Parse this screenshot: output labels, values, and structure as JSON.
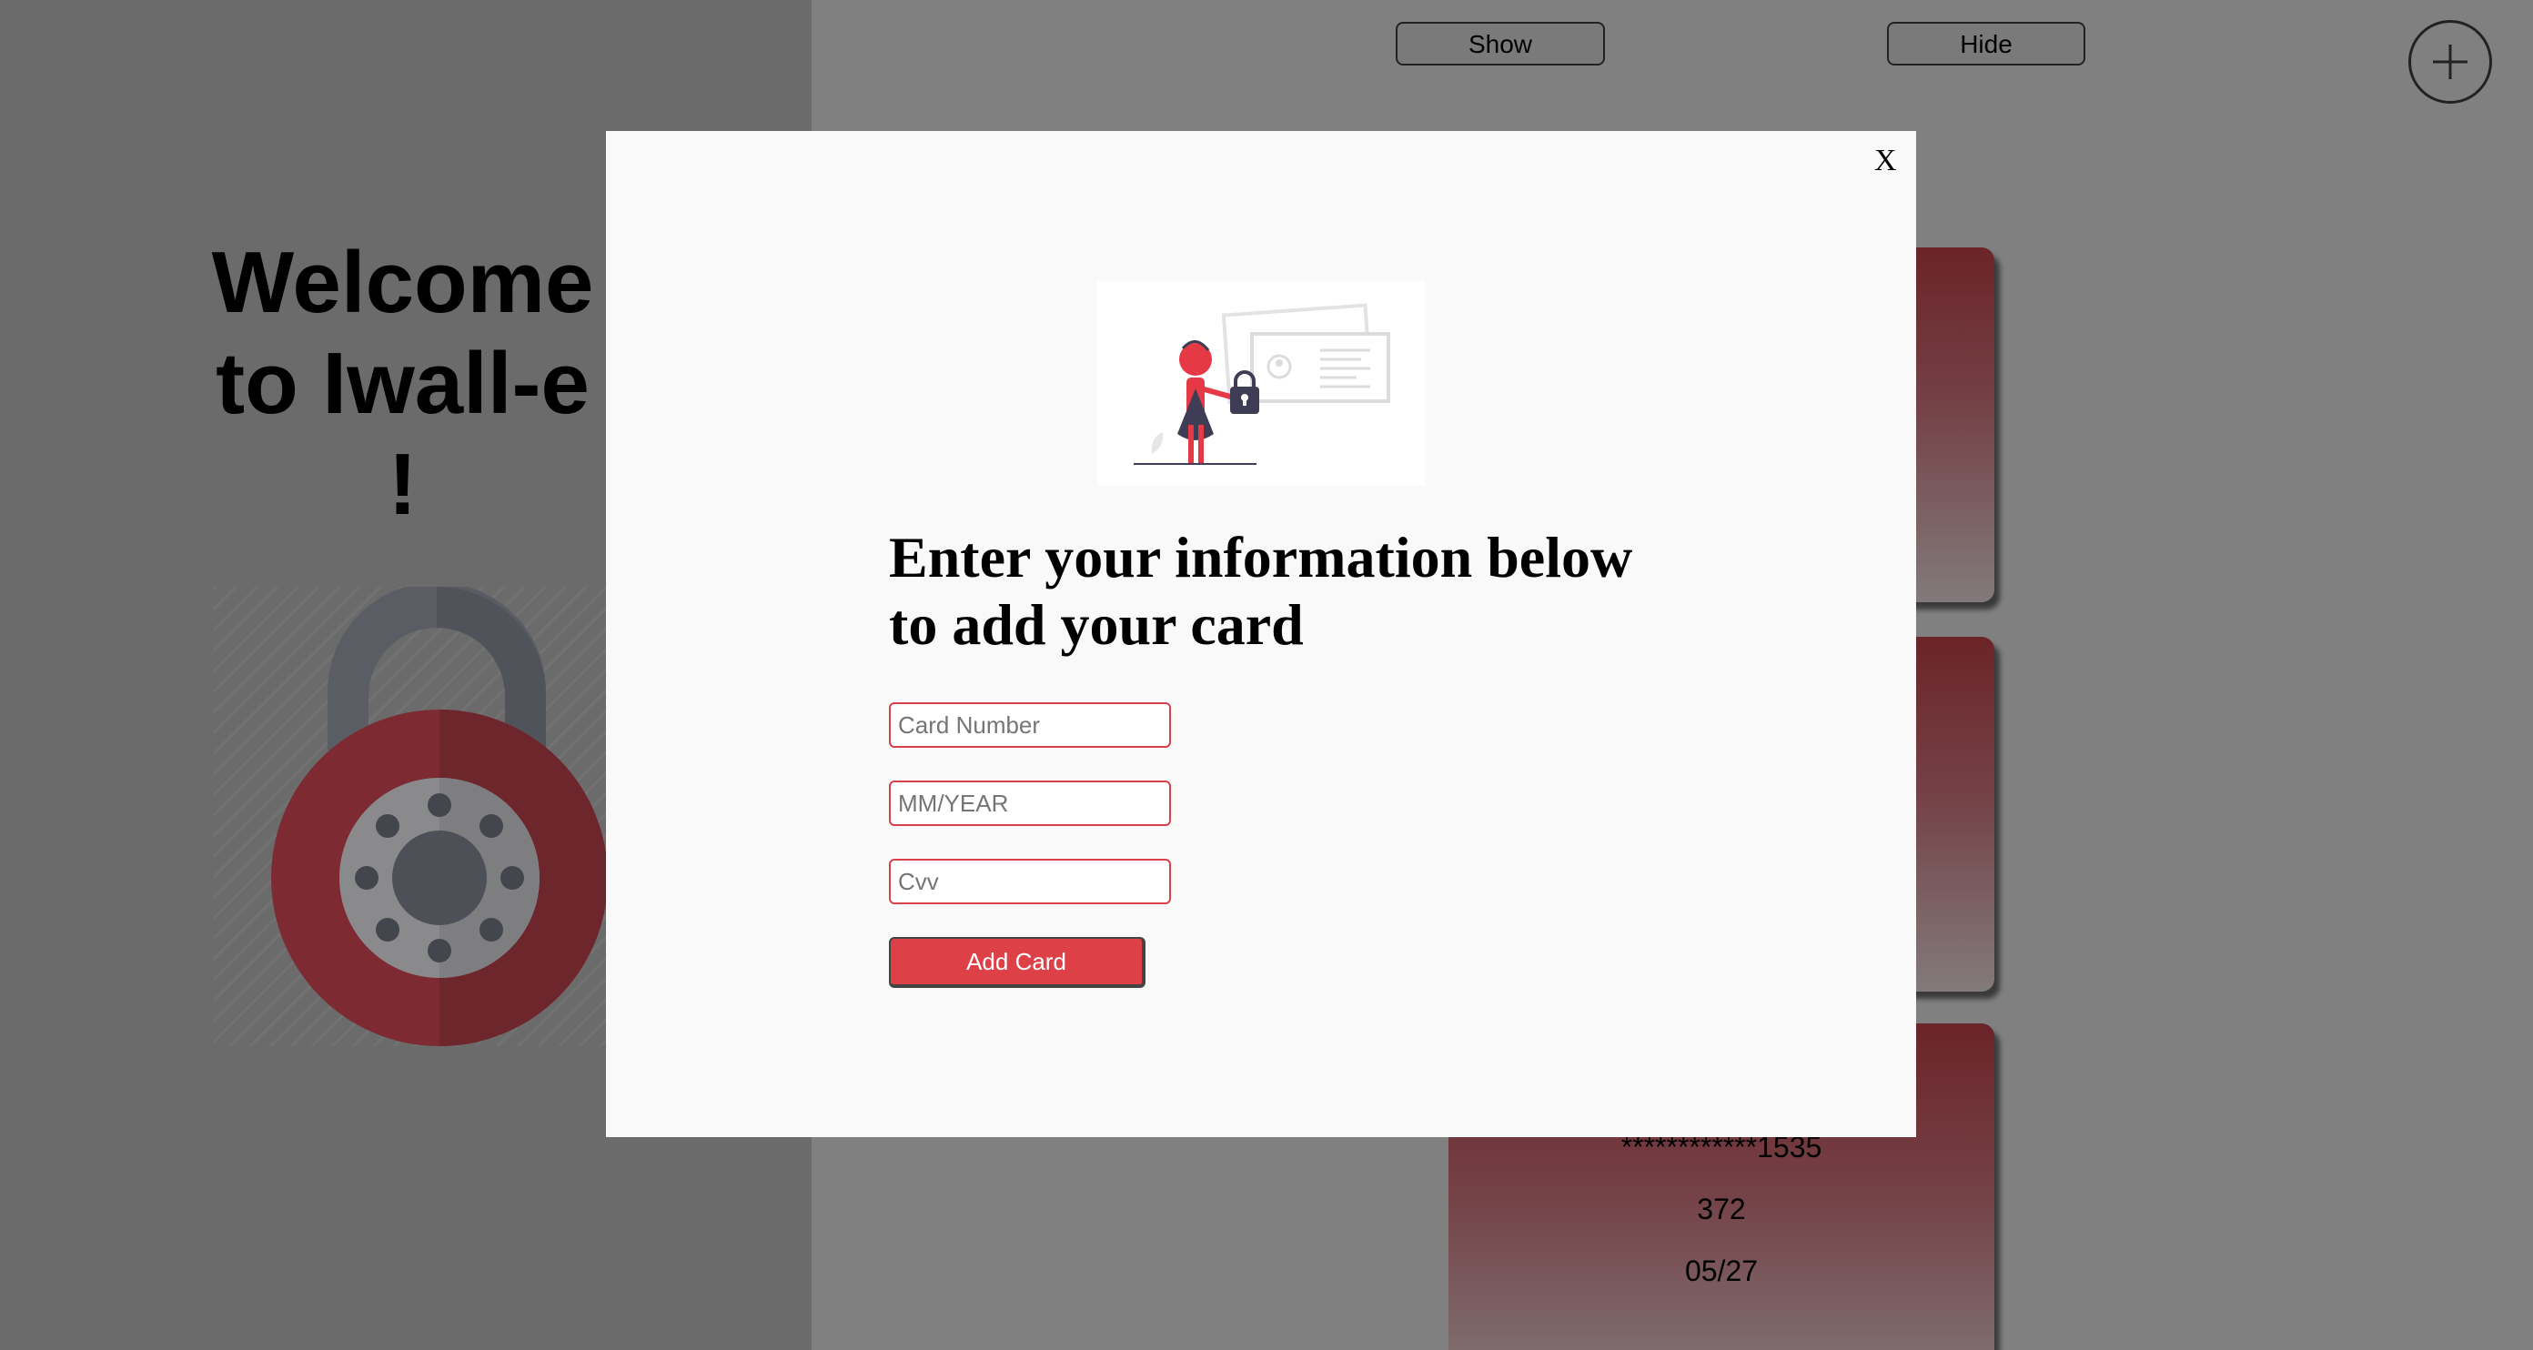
{
  "welcome": {
    "line1": "Welcome",
    "line2": "to Iwall-e",
    "line3": "!"
  },
  "toolbar": {
    "show_label": "Show",
    "hide_label": "Hide",
    "add_icon": "plus-circle-icon"
  },
  "cards": [
    {},
    {},
    {
      "number": "************1535",
      "cvv": "372",
      "expiry": "05/27"
    }
  ],
  "modal": {
    "close_label": "X",
    "heading_line1": "Enter your information below",
    "heading_line2": "to add your card",
    "card_number_placeholder": "Card Number",
    "expiry_placeholder": "MM/YEAR",
    "cvv_placeholder": "Cvv",
    "card_number_value": "",
    "expiry_value": "",
    "cvv_value": "",
    "submit_label": "Add Card"
  },
  "colors": {
    "overlay": "#808080",
    "left_panel": "#6b6b6b",
    "accent_red": "#de4048",
    "card_top": "#6b2428",
    "card_bottom": "#827a7b",
    "modal_bg": "#f9f9f9"
  }
}
